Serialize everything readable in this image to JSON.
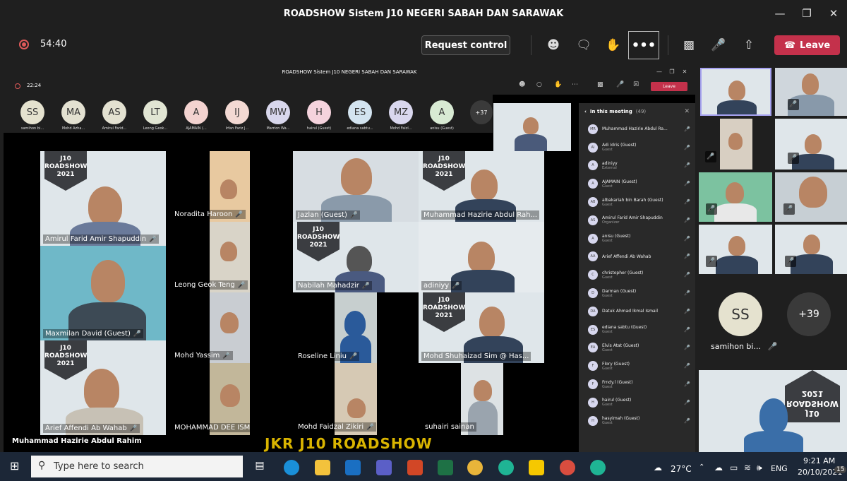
{
  "window": {
    "title": "ROADSHOW Sistem J10 NEGERI SABAH DAN SARAWAK"
  },
  "toolbar": {
    "timer": "54:40",
    "request_control": "Request control",
    "leave": "Leave",
    "more": "•••"
  },
  "inner": {
    "title": "ROADSHOW Sistem J10 NEGERI SABAH DAN SARAWAK",
    "timer": "22:24",
    "leave": "Leave"
  },
  "avatars": [
    {
      "initials": "SS",
      "name": "samihon bi...",
      "color": "#e5e2cf"
    },
    {
      "initials": "MA",
      "name": "Mohd Azha...",
      "color": "#e3e1d1"
    },
    {
      "initials": "AS",
      "name": "Amirul Farid...",
      "color": "#e3e1d1"
    },
    {
      "initials": "LT",
      "name": "Leong Geok...",
      "color": "#e1e5d3"
    },
    {
      "initials": "A",
      "name": "AJAMAIN (...",
      "color": "#f3d3d0"
    },
    {
      "initials": "IJ",
      "name": "Irfan Fariz J...",
      "color": "#f3d9d3"
    },
    {
      "initials": "MW",
      "name": "Marrion Wa...",
      "color": "#d8d7ec"
    },
    {
      "initials": "H",
      "name": "hairul (Guest)",
      "color": "#f5d3dd"
    },
    {
      "initials": "ES",
      "name": "ediana sabtu...",
      "color": "#d3e4f0"
    },
    {
      "initials": "MZ",
      "name": "Mohd Faizl...",
      "color": "#d9d7ee"
    },
    {
      "initials": "A",
      "name": "anisu (Guest)",
      "color": "#d8ead3"
    }
  ],
  "avatars_more": "+37",
  "tiles": {
    "amirul": "Amirul Farid Amir Shapuddin",
    "noradita": "Noradita Haroon",
    "jazlan": "Jazlan (Guest)",
    "hazirie": "Muhammad Hazirie Abdul Rah...",
    "leong": "Leong Geok Teng",
    "nabilah": "Nabilah Mahadzir",
    "adiniyy": "adiniyy",
    "maxmilan": "Maxmilan David (Guest)",
    "yassim": "Mohd Yassim",
    "roseline": "Roseline Liniu",
    "shuhaizad": "Mohd Shuhaizad Sim @ Has...",
    "arief": "Arief Affendi Ab Wahab",
    "dee": "MOHAMMAD DEE ISMAIL",
    "faidzal": "Mohd Faidzal Zikiri",
    "suhairi": "suhairi sainan"
  },
  "banner": {
    "line1": "J10",
    "line2": "ROADSHOW",
    "line3": "2021"
  },
  "presenter": "Muhammad Hazirie Abdul Rahim",
  "jkr_caption": "JKR J10 ROADSHOW",
  "panel": {
    "title": "In this meeting",
    "count": "(49)",
    "people": [
      {
        "ini": "MR",
        "name": "Muhammad Hazirie Abdul Ra...",
        "role": ""
      },
      {
        "ini": "AI",
        "name": "Adi Idris (Guest)",
        "role": "Guest"
      },
      {
        "ini": "A",
        "name": "adiniyy",
        "role": "External"
      },
      {
        "ini": "A",
        "name": "AJAMAIN (Guest)",
        "role": "Guest"
      },
      {
        "ini": "AB",
        "name": "albakariah bin Barah (Guest)",
        "role": "Guest"
      },
      {
        "ini": "AS",
        "name": "Amirul Farid Amir Shapuddin",
        "role": "Organizer"
      },
      {
        "ini": "A",
        "name": "anisu (Guest)",
        "role": "Guest"
      },
      {
        "ini": "AA",
        "name": "Arief Affendi Ab Wahab",
        "role": ""
      },
      {
        "ini": "C",
        "name": "christopher (Guest)",
        "role": "Guest"
      },
      {
        "ini": "D",
        "name": "Darman (Guest)",
        "role": "Guest"
      },
      {
        "ini": "DA",
        "name": "Datuk Ahmad Ikmal Ismail",
        "role": ""
      },
      {
        "ini": "ES",
        "name": "ediana sabtu (Guest)",
        "role": "Guest"
      },
      {
        "ini": "EA",
        "name": "Elvis Atat (Guest)",
        "role": "Guest"
      },
      {
        "ini": "F",
        "name": "Flory (Guest)",
        "role": "Guest"
      },
      {
        "ini": "F",
        "name": "Frndy.l (Guest)",
        "role": "Guest"
      },
      {
        "ini": "H",
        "name": "hairul (Guest)",
        "role": "Guest"
      },
      {
        "ini": "H",
        "name": "hasyimah (Guest)",
        "role": "Guest"
      }
    ]
  },
  "gallery": {
    "ss": "SS",
    "ss_name": "samihon bi...",
    "more": "+39"
  },
  "taskbar": {
    "search": "Type here to search",
    "temp": "27°C",
    "lang": "ENG",
    "time": "9:21 AM",
    "date": "20/10/2021",
    "badge": "15"
  }
}
